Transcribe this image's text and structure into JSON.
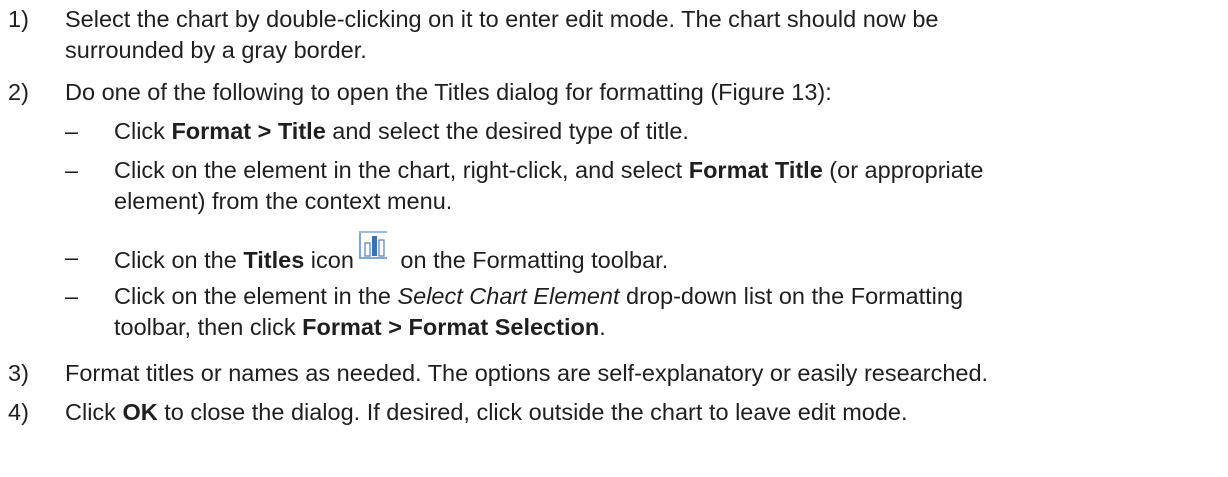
{
  "steps": [
    {
      "number": "1)",
      "text_a": "Select the chart by double-clicking on it to enter edit mode. The chart should now be",
      "text_b": "surrounded by a gray border."
    },
    {
      "number": "2)",
      "text_a": "Do one of the following to open the Titles dialog for formatting (Figure 13):"
    },
    {
      "number": "3)",
      "text_a": "Format titles or names as needed. The options are self-explanatory or easily researched."
    },
    {
      "number": "4)",
      "text_a_pre": "Click ",
      "text_a_bold": "OK",
      "text_a_post": " to close the dialog. If desired, click outside the chart to leave edit mode."
    }
  ],
  "substeps": [
    {
      "dash": "–",
      "pre": "Click ",
      "bold": "Format > Title",
      "post": " and select the desired type of title."
    },
    {
      "dash": "–",
      "line1_pre": "Click on the element in the chart, right-click, and select ",
      "line1_bold": "Format Title",
      "line1_post": " (or appropriate",
      "line2": "element) from the context menu."
    },
    {
      "dash": "–",
      "pre": "Click on the ",
      "bold": "Titles",
      "mid": " icon",
      "post": " on the Formatting toolbar.",
      "icon": "titles-icon"
    },
    {
      "dash": "–",
      "line1_pre": "Click on the element in the ",
      "line1_italic": "Select Chart Element",
      "line1_post": " drop-down list on the Formatting",
      "line2_pre": "toolbar, then click ",
      "line2_bold": "Format > Format Selection",
      "line2_post": "."
    }
  ]
}
